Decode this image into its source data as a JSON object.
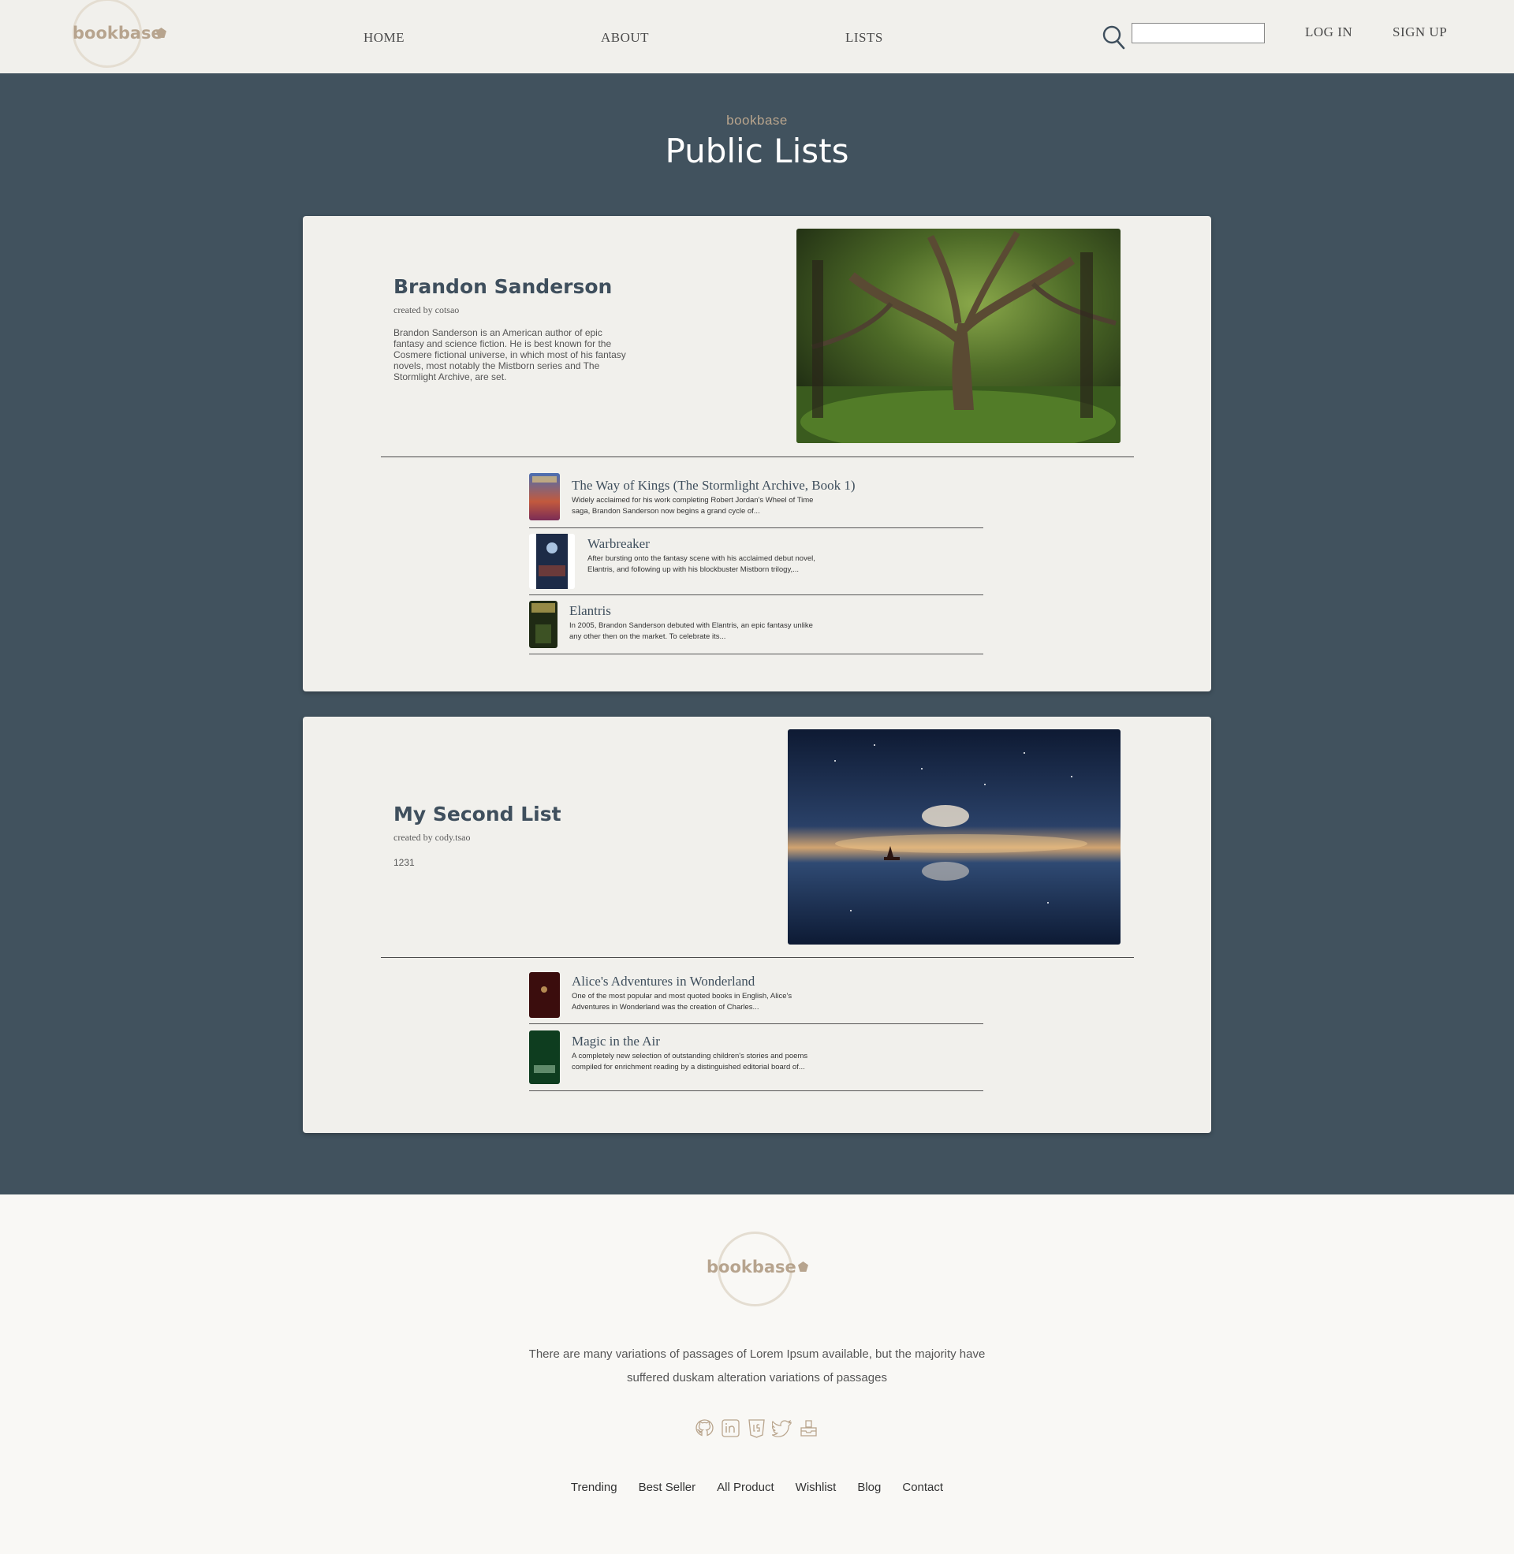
{
  "nav": {
    "logo_text": "bookbase",
    "links": [
      {
        "label": "HOME"
      },
      {
        "label": "ABOUT"
      },
      {
        "label": "LISTS"
      }
    ],
    "search_placeholder": "",
    "login_label": "LOG IN",
    "signup_label": "SIGN UP"
  },
  "hero": {
    "eyebrow": "bookbase",
    "title": "Public Lists"
  },
  "lists": [
    {
      "title": "Brandon Sanderson",
      "creator": "created by cotsao",
      "description": "Brandon Sanderson is an American author of epic fantasy and science fiction. He is best known for the Cosmere fictional universe, in which most of his fantasy novels, most notably the Mistborn series and The Stormlight Archive, are set.",
      "image": "forest-tree-photo",
      "books": [
        {
          "title": "The Way of Kings (The Stormlight Archive, Book 1)",
          "description": "Widely acclaimed for his work completing Robert Jordan's Wheel of Time saga, Brandon Sanderson now begins a grand cycle of..."
        },
        {
          "title": "Warbreaker",
          "description": "After bursting onto the fantasy scene with his acclaimed debut novel, Elantris, and following up with his blockbuster Mistborn trilogy,..."
        },
        {
          "title": "Elantris",
          "description": "In 2005, Brandon Sanderson debuted with Elantris, an epic fantasy unlike any other then on the market. To celebrate its..."
        }
      ]
    },
    {
      "title": "My Second List",
      "creator": "created by cody.tsao",
      "description": "1231",
      "image": "night-sky-sailboat-photo",
      "books": [
        {
          "title": "Alice's Adventures in Wonderland",
          "description": "One of the most popular and most quoted books in English, Alice's Adventures in Wonderland was the creation of Charles..."
        },
        {
          "title": "Magic in the Air",
          "description": "A completely new selection of outstanding children's stories and poems compiled for enrichment reading by a distinguished editorial board of..."
        }
      ]
    }
  ],
  "footer": {
    "logo_text": "bookbase",
    "text": "There are many variations of passages of Lorem Ipsum available, but the majority have suffered duskam alteration variations of passages",
    "socials": [
      "github-icon",
      "linkedin-icon",
      "html5-icon",
      "twitter-icon",
      "inbox-icon"
    ],
    "links": [
      "Trending",
      "Best Seller",
      "All Product",
      "Wishlist",
      "Blog",
      "Contact"
    ]
  },
  "colors": {
    "main_bg": "#41525e",
    "card_bg": "#f1f0ec",
    "accent": "#b9a58d",
    "title": "#3f4f5d"
  }
}
